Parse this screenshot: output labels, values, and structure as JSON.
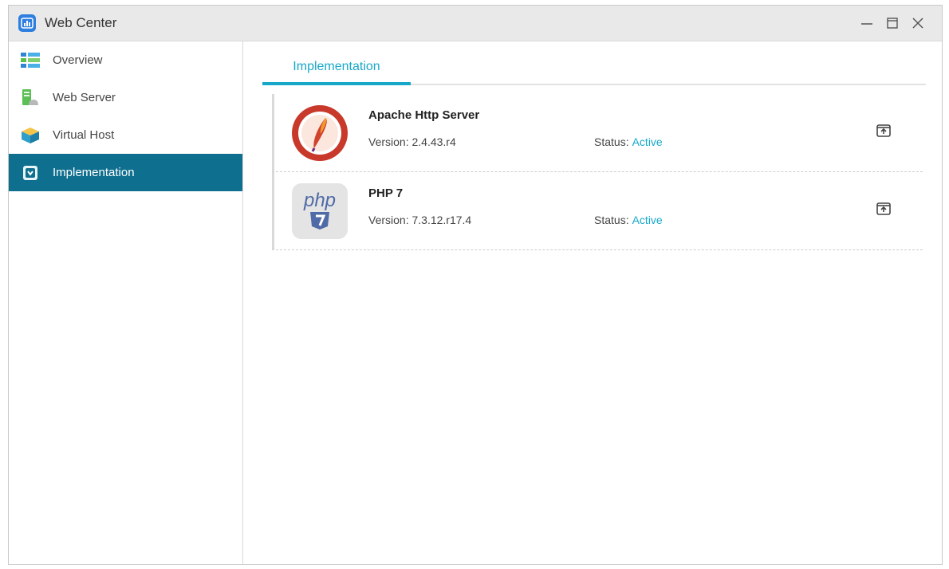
{
  "window": {
    "title": "Web Center"
  },
  "sidebar": {
    "items": [
      {
        "label": "Overview",
        "icon": "overview-list-icon",
        "active": false
      },
      {
        "label": "Web Server",
        "icon": "web-server-icon",
        "active": false
      },
      {
        "label": "Virtual Host",
        "icon": "virtual-host-cube-icon",
        "active": false
      },
      {
        "label": "Implementation",
        "icon": "implementation-icon",
        "active": true
      }
    ]
  },
  "tabs": [
    {
      "label": "Implementation",
      "active": true
    }
  ],
  "implementations": [
    {
      "name": "Apache Http Server",
      "version_label": "Version:",
      "version": "2.4.43.r4",
      "status_label": "Status:",
      "status": "Active",
      "logo": "apache-logo-icon"
    },
    {
      "name": "PHP 7",
      "version_label": "Version:",
      "version": "7.3.12.r17.4",
      "status_label": "Status:",
      "status": "Active",
      "logo": "php-logo-icon",
      "logo_text": "php"
    }
  ],
  "colors": {
    "accent": "#17a8c9",
    "sidebar_active": "#0f6f8f",
    "titlebar": "#e9e9e9"
  }
}
